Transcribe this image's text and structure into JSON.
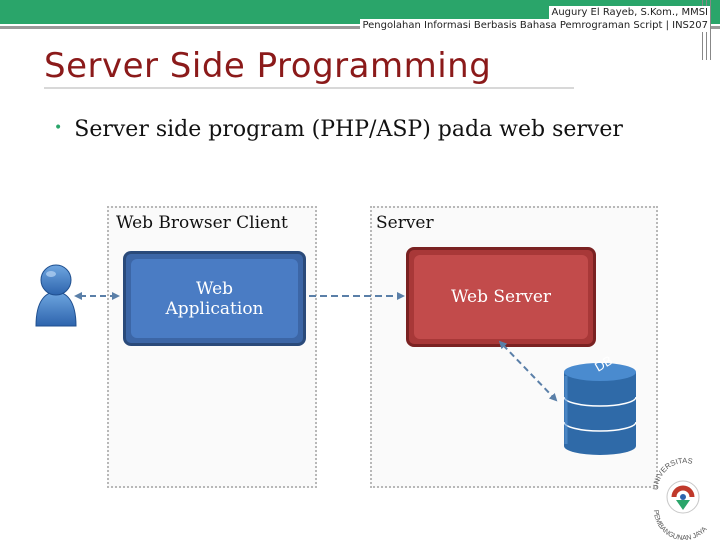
{
  "header": {
    "author": "Augury El Rayeb, S.Kom., MMSI",
    "course": "Pengolahan Informasi Berbasis Bahasa Pemrograman Script | INS207"
  },
  "slide": {
    "title": "Server Side Programming",
    "bullet": "Server side program (PHP/ASP) pada web server"
  },
  "diagram": {
    "client_panel_label": "Web Browser Client",
    "server_panel_label": "Server",
    "web_application_label": "Web\nApplication",
    "web_server_label": "Web Server",
    "db_label": "DB"
  },
  "logo": {
    "text_top": "UNIVERSITAS",
    "text_bottom": "PEMBANGUNAN JAYA"
  },
  "colors": {
    "accent_green": "#2aa56a",
    "title_red": "#8b1a1a",
    "web_app_blue": "#4a7cc4",
    "web_server_red": "#c24b4b",
    "db_blue": "#2f6aa8"
  }
}
